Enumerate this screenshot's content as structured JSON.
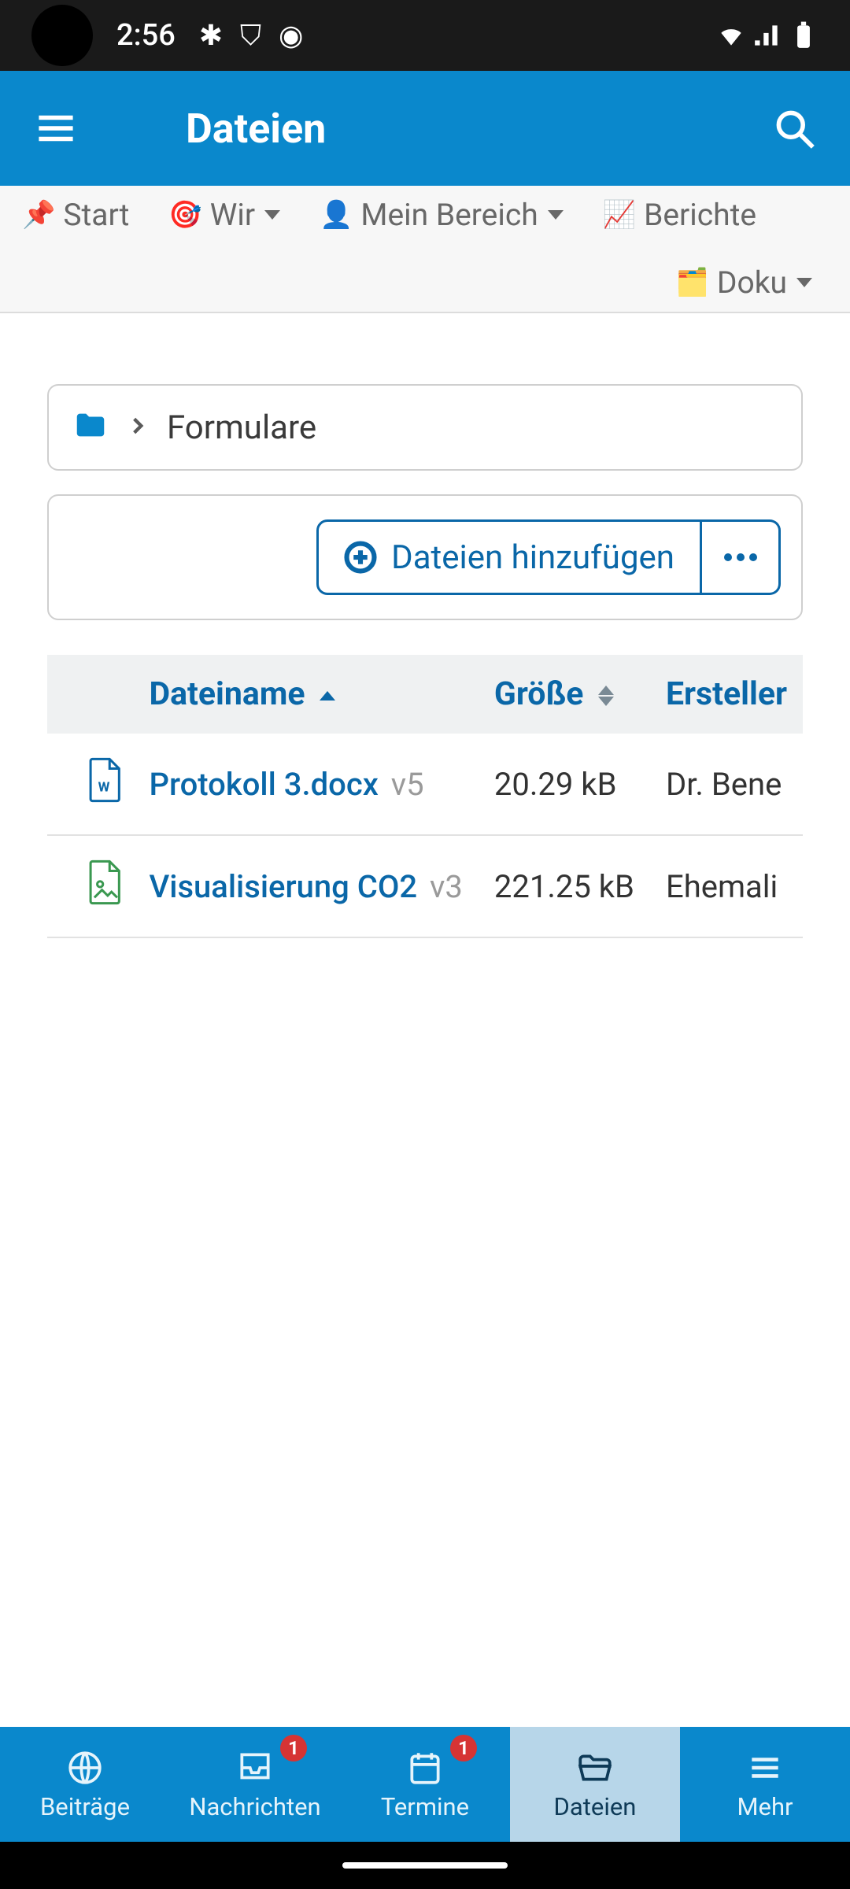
{
  "status": {
    "time": "2:56"
  },
  "header": {
    "title": "Dateien"
  },
  "secondaryNav": {
    "items": [
      {
        "emoji": "📌",
        "label": "Start",
        "dropdown": false
      },
      {
        "emoji": "🎯",
        "label": "Wir",
        "dropdown": true
      },
      {
        "emoji": "👤",
        "label": "Mein Bereich",
        "dropdown": true
      },
      {
        "emoji": "📈",
        "label": "Berichte",
        "dropdown": false
      },
      {
        "emoji": "🗂️",
        "label": "Doku",
        "dropdown": true
      }
    ]
  },
  "breadcrumb": {
    "current": "Formulare"
  },
  "toolbar": {
    "addLabel": "Dateien hinzufügen"
  },
  "table": {
    "columns": {
      "name": "Dateiname",
      "size": "Größe",
      "creator": "Ersteller"
    },
    "rows": [
      {
        "iconType": "word",
        "name": "Protokoll 3.docx",
        "version": "v5",
        "size": "20.29 kB",
        "creator": "Dr. Bene"
      },
      {
        "iconType": "image",
        "name": "Visualisierung CO2",
        "version": "v3",
        "size": "221.25 kB",
        "creator": "Ehemali"
      }
    ]
  },
  "bottomNav": {
    "items": [
      {
        "label": "Beiträge",
        "badge": null,
        "active": false
      },
      {
        "label": "Nachrichten",
        "badge": "1",
        "active": false
      },
      {
        "label": "Termine",
        "badge": "1",
        "active": false
      },
      {
        "label": "Dateien",
        "badge": null,
        "active": true
      },
      {
        "label": "Mehr",
        "badge": null,
        "active": false
      }
    ]
  }
}
